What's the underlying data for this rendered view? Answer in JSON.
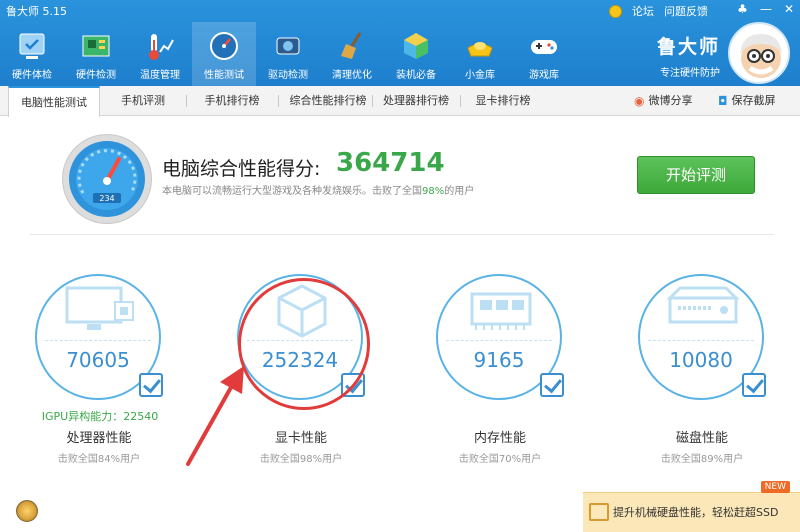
{
  "window": {
    "title": "鲁大师 5.15",
    "links": [
      "论坛",
      "问题反馈"
    ],
    "controls": [
      "skin-icon",
      "minimize-icon",
      "close-icon"
    ]
  },
  "nav": {
    "items": [
      {
        "label": "硬件体检",
        "icon": "hardware-check-icon"
      },
      {
        "label": "硬件检测",
        "icon": "motherboard-icon"
      },
      {
        "label": "温度管理",
        "icon": "thermometer-icon"
      },
      {
        "label": "性能测试",
        "icon": "speedometer-icon",
        "active": true
      },
      {
        "label": "驱动检测",
        "icon": "driver-icon"
      },
      {
        "label": "清理优化",
        "icon": "broom-icon"
      },
      {
        "label": "装机必备",
        "icon": "cube-icon"
      },
      {
        "label": "小金库",
        "icon": "gold-ingot-icon"
      },
      {
        "label": "游戏库",
        "icon": "gamepad-icon"
      }
    ]
  },
  "brand": {
    "name": "鲁大师",
    "slogan": "专注硬件防护"
  },
  "tabs": [
    {
      "label": "电脑性能测试",
      "active": true
    },
    {
      "label": "手机评测"
    },
    {
      "label": "手机排行榜"
    },
    {
      "label": "综合性能排行榜"
    },
    {
      "label": "处理器排行榜"
    },
    {
      "label": "显卡排行榜"
    }
  ],
  "tab_actions": {
    "share": "微博分享",
    "screenshot": "保存截屏"
  },
  "score": {
    "label": "电脑综合性能得分:",
    "value": "364714",
    "desc_before": "本电脑可以流畅运行大型游戏及各种发烧娱乐。击败了全国",
    "desc_pct": "98%",
    "desc_after": "的用户",
    "gauge_readout": "234"
  },
  "start_button": "开始评测",
  "cards": [
    {
      "value": "70605",
      "title": "处理器性能",
      "desc": "击败全国84%用户",
      "extra": "IGPU异构能力：22540",
      "icon": "monitor-cpu-icon"
    },
    {
      "value": "252324",
      "title": "显卡性能",
      "desc": "击败全国98%用户",
      "icon": "gpu-cube-icon"
    },
    {
      "value": "9165",
      "title": "内存性能",
      "desc": "击败全国70%用户",
      "icon": "memory-chip-icon"
    },
    {
      "value": "10080",
      "title": "磁盘性能",
      "desc": "击败全国89%用户",
      "icon": "hard-disk-icon"
    }
  ],
  "ad": {
    "text": "提升机械硬盘性能，轻松赶超SSD",
    "badge": "NEW"
  },
  "colors": {
    "header": "#2a93dc",
    "score_green": "#3aa84a",
    "card_blue": "#3b8fd0",
    "annotation_red": "#e23b3b"
  }
}
